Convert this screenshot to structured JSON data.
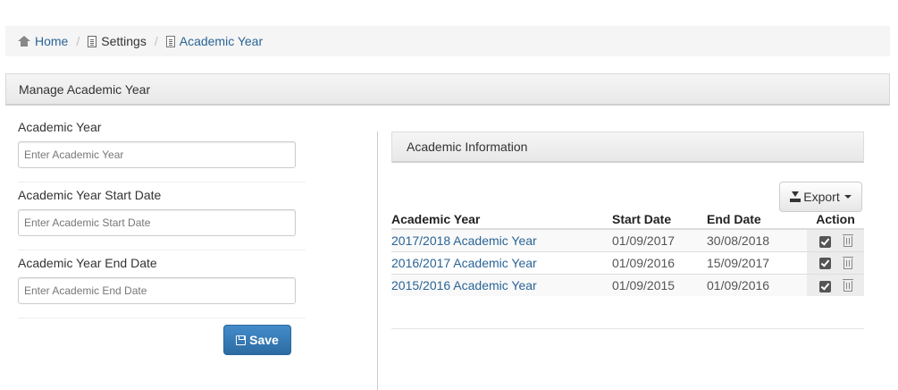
{
  "breadcrumb": {
    "home": "Home",
    "settings": "Settings",
    "current": "Academic Year"
  },
  "panel": {
    "title": "Manage Academic Year"
  },
  "form": {
    "year_label": "Academic Year",
    "year_placeholder": "Enter Academic Year",
    "start_label": "Academic Year Start Date",
    "start_placeholder": "Enter Academic Start Date",
    "end_label": "Academic Year End Date",
    "end_placeholder": "Enter Academic End Date",
    "save_label": "Save"
  },
  "info": {
    "title": "Academic Information",
    "export_label": "Export",
    "columns": [
      "Academic Year",
      "Start Date",
      "End Date",
      "Action"
    ],
    "rows": [
      {
        "year": "2017/2018 Academic Year",
        "start": "01/09/2017",
        "end": "30/08/2018"
      },
      {
        "year": "2016/2017 Academic Year",
        "start": "01/09/2016",
        "end": "15/09/2017"
      },
      {
        "year": "2015/2016 Academic Year",
        "start": "01/09/2015",
        "end": "01/09/2016"
      }
    ]
  },
  "colors": {
    "link": "#2a6496",
    "primary_button": "#428bca"
  },
  "icons": {
    "home": "home-icon",
    "settings": "document-icon",
    "current": "file-icon",
    "save": "floppy-disk-icon",
    "export": "download-icon",
    "edit": "check-square-icon",
    "delete": "trash-icon"
  }
}
